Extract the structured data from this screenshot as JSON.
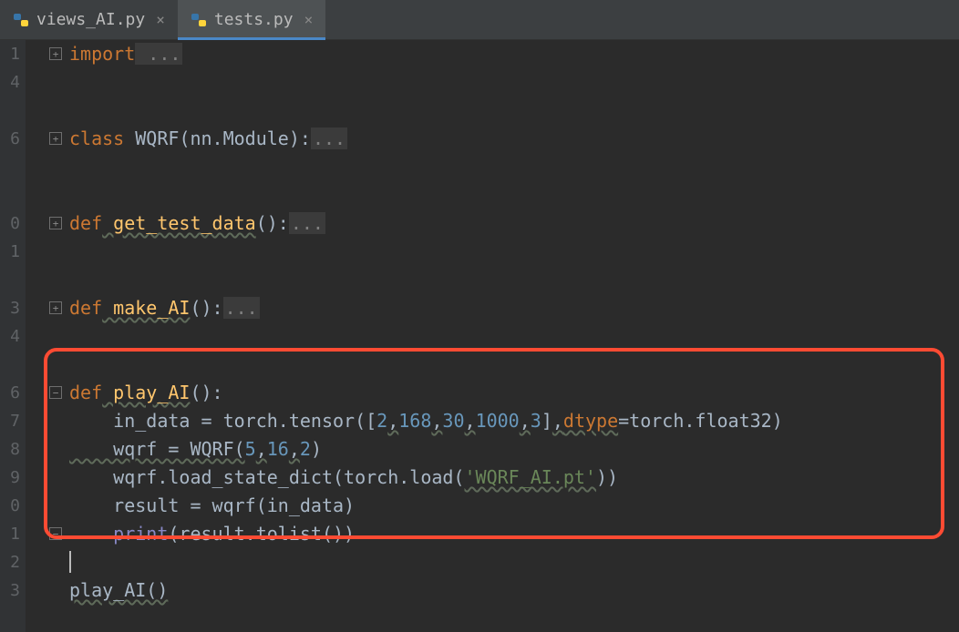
{
  "tabs": [
    {
      "label": "views_AI.py",
      "active": false
    },
    {
      "label": "tests.py",
      "active": true
    }
  ],
  "gutter_lines": [
    "1",
    "4",
    "",
    "6",
    "",
    "",
    "0",
    "1",
    "",
    "3",
    "4",
    "",
    "6",
    "7",
    "8",
    "9",
    "0",
    "1",
    "2",
    "3"
  ],
  "fold_plus_rows": [
    0,
    3,
    6,
    9
  ],
  "fold_minus_rows": [
    12,
    17
  ],
  "code": {
    "l1_kw": "import",
    "l1_folded": " ...",
    "l4_kw": "class",
    "l4_cls": " WQRF",
    "l4_rest": "(nn.Module):",
    "l4_folded": "...",
    "l7_kw": "def",
    "l7_fn": " get_test_data",
    "l7_rest": "():",
    "l7_folded": "...",
    "l10_kw": "def",
    "l10_fn": " make_AI",
    "l10_rest": "():",
    "l10_folded": "...",
    "l13_kw": "def",
    "l13_fn": " play_AI",
    "l13_rest": "():",
    "l14_a": "    in_data = torch.tensor([",
    "l14_n1": "2",
    "l14_c": ",",
    "l14_n2": "168",
    "l14_n3": "30",
    "l14_n4": "1000",
    "l14_n5": "3",
    "l14_b": "]",
    "l14_dtype": "dtype",
    "l14_eq": "=torch.float32)",
    "l15_a": "    wqrf = WQRF(",
    "l15_n1": "5",
    "l15_n2": "16",
    "l15_n3": "2",
    "l15_b": ")",
    "l16_a": "    wqrf.load_state_dict(torch.load(",
    "l16_s": "'WQRF_AI.pt'",
    "l16_b": "))",
    "l17": "    result = wqrf(in_data)",
    "l18_a": "    ",
    "l18_print": "print",
    "l18_b": "(result.tolist())",
    "l20": "play_AI()"
  }
}
